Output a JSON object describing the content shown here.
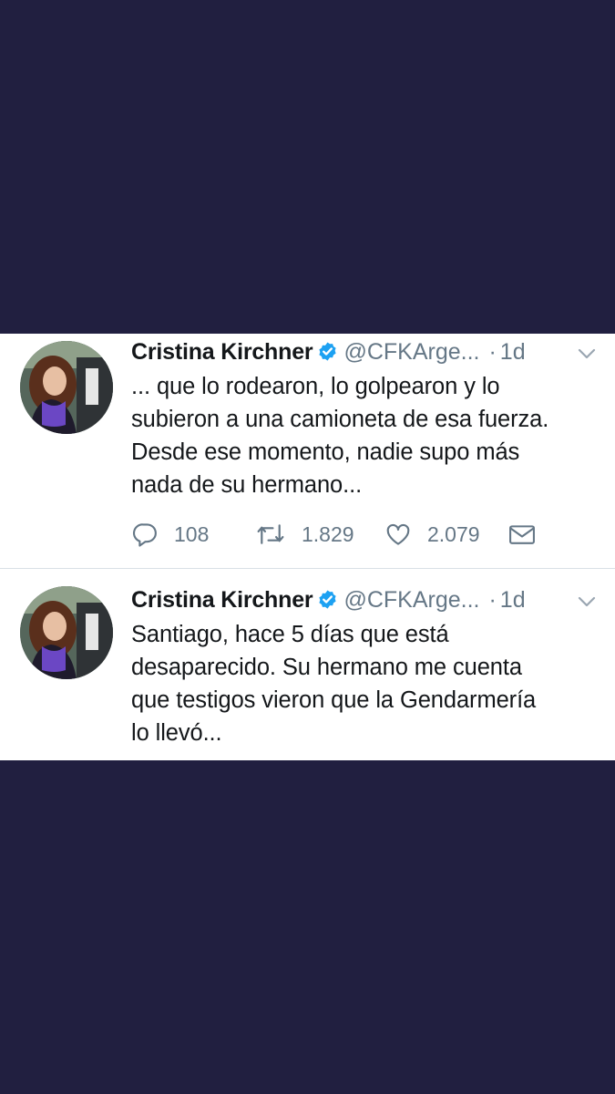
{
  "colors": {
    "page_background": "#211f40",
    "card_background": "#ffffff",
    "text_primary": "#14171a",
    "text_secondary": "#657786",
    "verified_blue": "#1da1f2"
  },
  "tweets": [
    {
      "author": "Cristina Kirchner",
      "handle": "@CFKArge...",
      "separator": "·",
      "time": "1d",
      "verified_icon": "verified-badge-icon",
      "lines": [
        "... que lo rodearon, lo golpearon y lo",
        "subieron a una camioneta de esa fuerza.",
        "Desde ese momento, nadie supo más",
        "nada de su hermano..."
      ],
      "actions": {
        "reply_icon": "reply-icon",
        "replies": "108",
        "retweet_icon": "retweet-icon",
        "retweets": "1.829",
        "like_icon": "heart-icon",
        "likes": "2.079",
        "dm_icon": "envelope-icon"
      }
    },
    {
      "author": "Cristina Kirchner",
      "handle": "@CFKArge...",
      "separator": "·",
      "time": "1d",
      "verified_icon": "verified-badge-icon",
      "lines": [
        "Santiago, hace 5 días que está",
        "desaparecido. Su hermano me cuenta",
        "que testigos vieron que la Gendarmería",
        "lo llevó..."
      ]
    }
  ]
}
